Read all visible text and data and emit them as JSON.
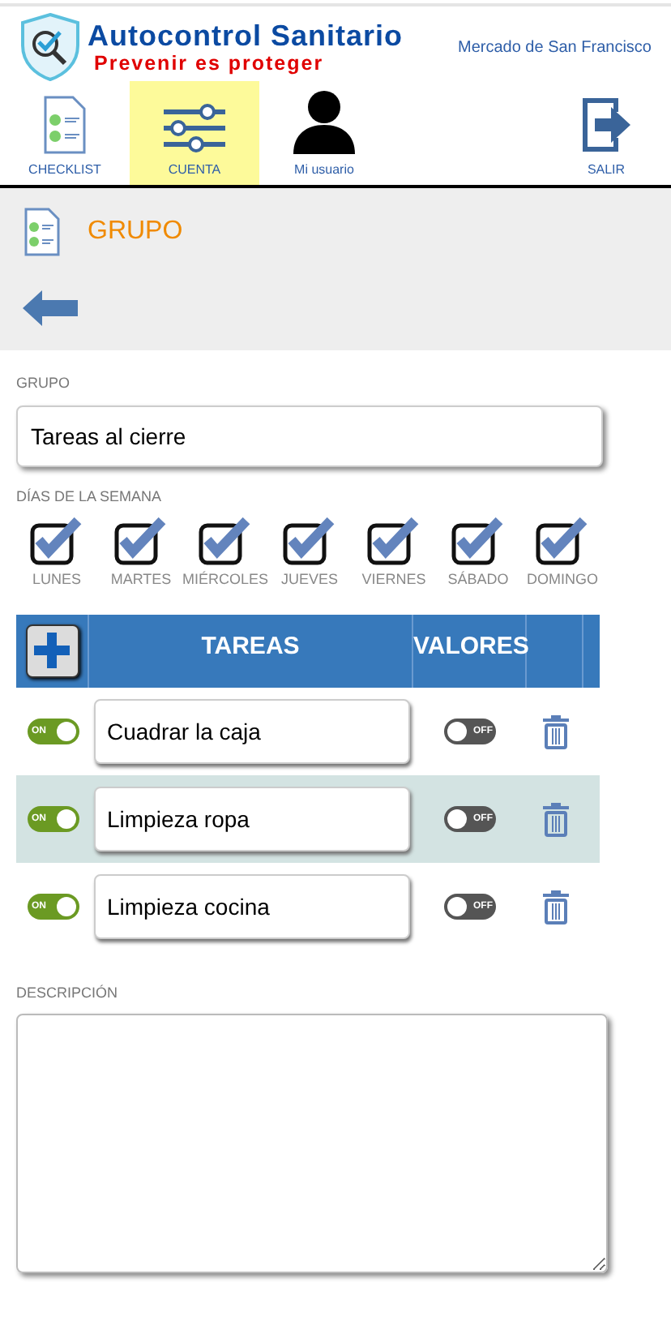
{
  "header": {
    "brand": "Autocontrol Sanitario",
    "slogan": "Prevenir es proteger",
    "location": "Mercado de San Francisco"
  },
  "nav": [
    {
      "kind": "checklist",
      "label": "CHECKLIST",
      "selected": false
    },
    {
      "kind": "account",
      "label": "CUENTA",
      "selected": true
    },
    {
      "kind": "user",
      "label": "Mi usuario",
      "selected": false
    },
    {
      "kind": "logout",
      "label": "SALIR",
      "selected": false
    }
  ],
  "page_title": "GRUPO",
  "group": {
    "label": "GRUPO",
    "value": "Tareas al cierre"
  },
  "days": {
    "label": "DÍAS DE LA SEMANA",
    "items": [
      {
        "label": "LUNES",
        "checked": true
      },
      {
        "label": "MARTES",
        "checked": true
      },
      {
        "label": "MIÉRCOLES",
        "checked": true
      },
      {
        "label": "JUEVES",
        "checked": true
      },
      {
        "label": "VIERNES",
        "checked": true
      },
      {
        "label": "SÁBADO",
        "checked": true
      },
      {
        "label": "DOMINGO",
        "checked": true
      }
    ]
  },
  "table": {
    "columns": [
      "TAREAS",
      "VALORES"
    ],
    "rows": [
      {
        "active": {
          "on": true,
          "label": "ON"
        },
        "task": "Cuadrar la caja",
        "values": {
          "on": false,
          "label": "OFF"
        },
        "selected": false
      },
      {
        "active": {
          "on": true,
          "label": "ON"
        },
        "task": "Limpieza ropa",
        "values": {
          "on": false,
          "label": "OFF"
        },
        "selected": true
      },
      {
        "active": {
          "on": true,
          "label": "ON"
        },
        "task": "Limpieza cocina",
        "values": {
          "on": false,
          "label": "OFF"
        },
        "selected": false
      }
    ]
  },
  "description": {
    "label": "DESCRIPCIÓN"
  }
}
